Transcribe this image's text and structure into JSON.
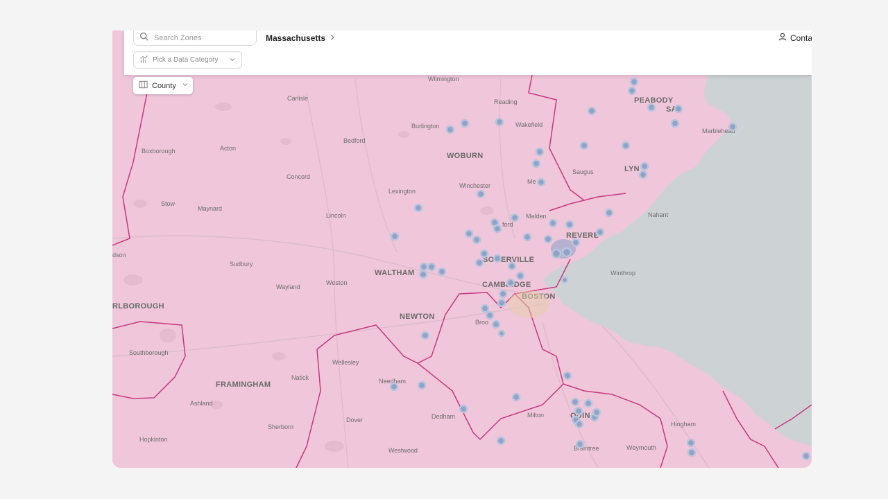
{
  "search": {
    "placeholder": "Search Zones"
  },
  "category": {
    "placeholder": "Pick a Data Category"
  },
  "breadcrumb": {
    "region": "Massachusetts"
  },
  "header": {
    "contact_label": "Contact"
  },
  "boundary_selector": {
    "label": "County"
  },
  "colors": {
    "land": "#efc6da",
    "water": "#cdd3d4",
    "boundary": "#c8387e",
    "marker": "#8fa3c8",
    "marker_ring": "#b9c4dc"
  },
  "map": {
    "towns": [
      "Wilmington",
      "Carlisle",
      "Reading",
      "Burlington",
      "Wakefield",
      "Bedford",
      "Boxborough",
      "Acton",
      "Concord",
      "Woburn",
      "Winchester",
      "Saugus",
      "Lexington",
      "Stow",
      "Maynard",
      "Lincoln",
      "Malden",
      "Hudson",
      "Sudbury",
      "Waltham",
      "Wayland",
      "Weston",
      "Marlborough",
      "Newton",
      "Brookline",
      "Southborough",
      "Wellesley",
      "Needham",
      "Natick",
      "Framingham",
      "Ashland",
      "Dover",
      "Sherborn",
      "Dedham",
      "Milton",
      "Hingham",
      "Westwood",
      "Hopkinton",
      "Braintree",
      "Weymouth",
      "Nahant",
      "Winthrop",
      "Marblehead",
      "Medford",
      "Melrose"
    ],
    "cities": [
      "Peabody",
      "Salem",
      "Lynn",
      "Revere",
      "Somerville",
      "Cambridge",
      "Boston",
      "Quincy"
    ],
    "towns_display": {
      "Marlborough": "RLBOROUGH",
      "Hudson": "dson",
      "Medford": "ford",
      "Melrose": "Me",
      "Salem": "SA",
      "Lynn": "LYN",
      "Quincy": "QUIN",
      "Brookline": "Broo",
      "Somerville": "SOMERVILLE",
      "Cambridge": "CAMBRIDGE"
    }
  }
}
